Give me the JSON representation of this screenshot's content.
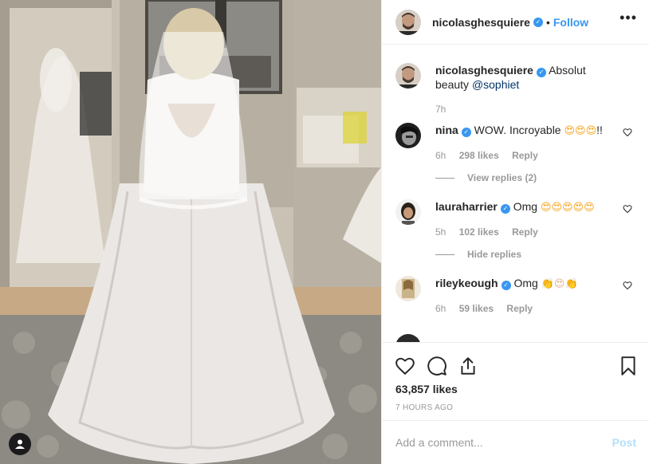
{
  "photo": {
    "subject": "wedding-dress-back-view",
    "user_tag_icon": "user-tag-icon"
  },
  "header": {
    "username": "nicolasghesquiere",
    "verified": true,
    "separator": "•",
    "follow_label": "Follow",
    "more_icon": "ellipsis-icon"
  },
  "caption": {
    "username": "nicolasghesquiere",
    "text": "Absolut beauty",
    "mention": "@sophiet",
    "time": "7h"
  },
  "comments": [
    {
      "username": "nina",
      "text": "WOW. Incroyable",
      "emoji": "😍😍😍",
      "suffix": "!!",
      "time": "6h",
      "likes": "298 likes",
      "reply_label": "Reply",
      "replies_toggle": "View replies (2)"
    },
    {
      "username": "lauraharrier",
      "text": "Omg",
      "emoji": "😍😍😍😍😍",
      "suffix": "",
      "time": "5h",
      "likes": "102 likes",
      "reply_label": "Reply",
      "replies_toggle": "Hide replies"
    },
    {
      "username": "rileykeough",
      "text": "Omg",
      "emoji": "👏😍👏",
      "suffix": "",
      "time": "6h",
      "likes": "59 likes",
      "reply_label": "Reply",
      "replies_toggle": ""
    }
  ],
  "actions": {
    "like_icon": "heart-icon",
    "comment_icon": "comment-icon",
    "share_icon": "share-icon",
    "save_icon": "bookmark-icon",
    "likes_count": "63,857 likes",
    "posted": "7 HOURS AGO"
  },
  "composer": {
    "placeholder": "Add a comment...",
    "post_label": "Post"
  },
  "colors": {
    "accent": "#3897f0",
    "post_disabled": "#b2dffc",
    "muted": "#999999",
    "text": "#262626"
  }
}
